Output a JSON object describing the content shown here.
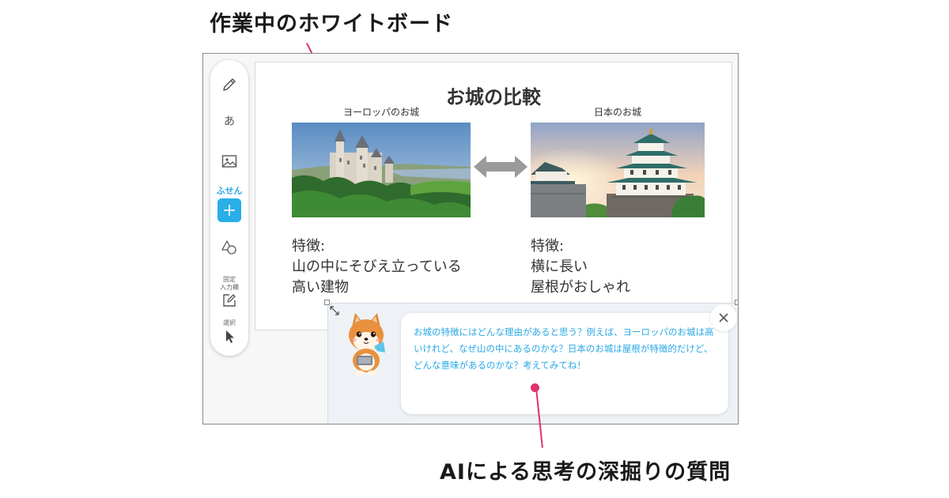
{
  "annotations": {
    "whiteboard_label": "作業中のホワイトボード",
    "ai_question_label": "AIによる思考の深掘りの質問"
  },
  "toolbar": {
    "text_tool_glyph": "あ",
    "sticky_label": "ふせん",
    "fixed_input_label_line1": "固定",
    "fixed_input_label_line2": "入力欄",
    "select_label": "選択"
  },
  "board": {
    "title": "お城の比較",
    "left": {
      "caption": "ヨーロッパのお城",
      "feature_heading": "特徴:",
      "feature_line1": "山の中にそびえ立っている",
      "feature_line2": "高い建物"
    },
    "right": {
      "caption": "日本のお城",
      "feature_heading": "特徴:",
      "feature_line1": "横に長い",
      "feature_line2": "屋根がおしゃれ"
    }
  },
  "ai_chat": {
    "message": "お城の特徴にはどんな理由があると思う？例えば、ヨーロッパのお城は高いけれど、なぜ山の中にあるのかな？日本のお城は屋根が特徴的だけど、どんな意味があるのかな？考えてみてね！"
  },
  "colors": {
    "accent": "#29aee8",
    "pointer": "#e0336a",
    "chat_text": "#2aa8e6"
  },
  "icons": [
    "pencil-icon",
    "image-icon",
    "plus-icon",
    "shapes-icon",
    "edit-box-icon",
    "cursor-icon",
    "resize-icon",
    "close-icon",
    "double-arrow-icon",
    "shiba-mascot-icon"
  ]
}
